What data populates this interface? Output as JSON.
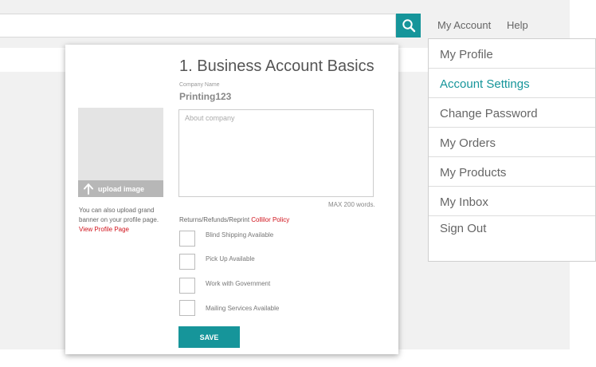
{
  "header": {
    "search": {
      "value": "",
      "placeholder": ""
    },
    "nav": {
      "my_account": "My Account",
      "help": "Help"
    },
    "colors": {
      "accent": "#16959a"
    }
  },
  "account_menu": {
    "items": [
      {
        "label": "My Profile",
        "active": false
      },
      {
        "label": "Account Settings",
        "active": true
      },
      {
        "label": "Change Password",
        "active": false
      },
      {
        "label": "My Orders",
        "active": false
      },
      {
        "label": "My Products",
        "active": false
      },
      {
        "label": "My Inbox",
        "active": false
      },
      {
        "label": "Sign Out",
        "active": false
      }
    ]
  },
  "form": {
    "title": "1. Business Account Basics",
    "company_name_label": "Company Name",
    "company_name_value": "Printing123",
    "about_placeholder": "About company",
    "max_words": "MAX 200 words.",
    "policy_text": "Returns/Refunds/Reprint",
    "policy_link": "Collilor Policy",
    "options": [
      {
        "label": "Blind Shipping Available",
        "checked": false
      },
      {
        "label": "Pick Up Available",
        "checked": false
      },
      {
        "label": "Work with Government",
        "checked": false
      },
      {
        "label": "Mailing Services Available",
        "checked": false
      }
    ],
    "save_label": "SAVE"
  },
  "profile_image": {
    "upload_label": "upload image",
    "note": "You can also upload grand banner on your profile page.",
    "view_link": "View Profile Page"
  }
}
